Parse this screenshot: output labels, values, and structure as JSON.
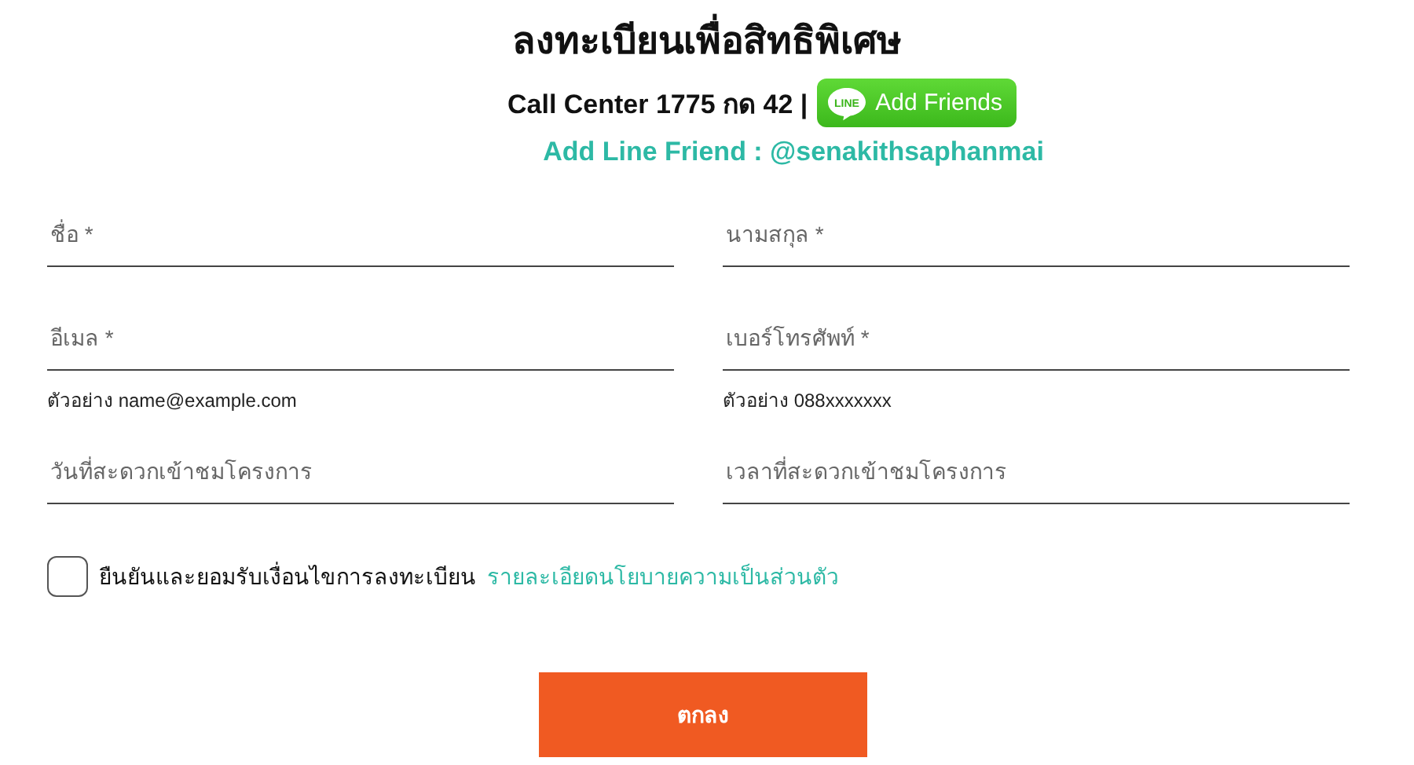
{
  "title": "ลงทะเบียนเพื่อสิทธิพิเศษ",
  "call_center": "Call Center 1775 กด 42 |",
  "line_button": {
    "logo": "LINE",
    "label": "Add Friends"
  },
  "line_friend": "Add Line Friend : @senakithsaphanmai",
  "fields": [
    {
      "placeholder": "ชื่อ *"
    },
    {
      "placeholder": "นามสกุล *"
    },
    {
      "placeholder": "อีเมล *",
      "hint": "ตัวอย่าง name@example.com"
    },
    {
      "placeholder": "เบอร์โทรศัพท์ *",
      "hint": "ตัวอย่าง 088xxxxxxx"
    },
    {
      "placeholder": "วันที่สะดวกเข้าชมโครงการ"
    },
    {
      "placeholder": "เวลาที่สะดวกเข้าชมโครงการ"
    }
  ],
  "consent": {
    "checked": false,
    "text": "ยืนยันและยอมรับเงื่อนไขการลงทะเบียน",
    "link": "รายละเอียดนโยบายความเป็นส่วนตัว"
  },
  "submit": "ตกลง"
}
